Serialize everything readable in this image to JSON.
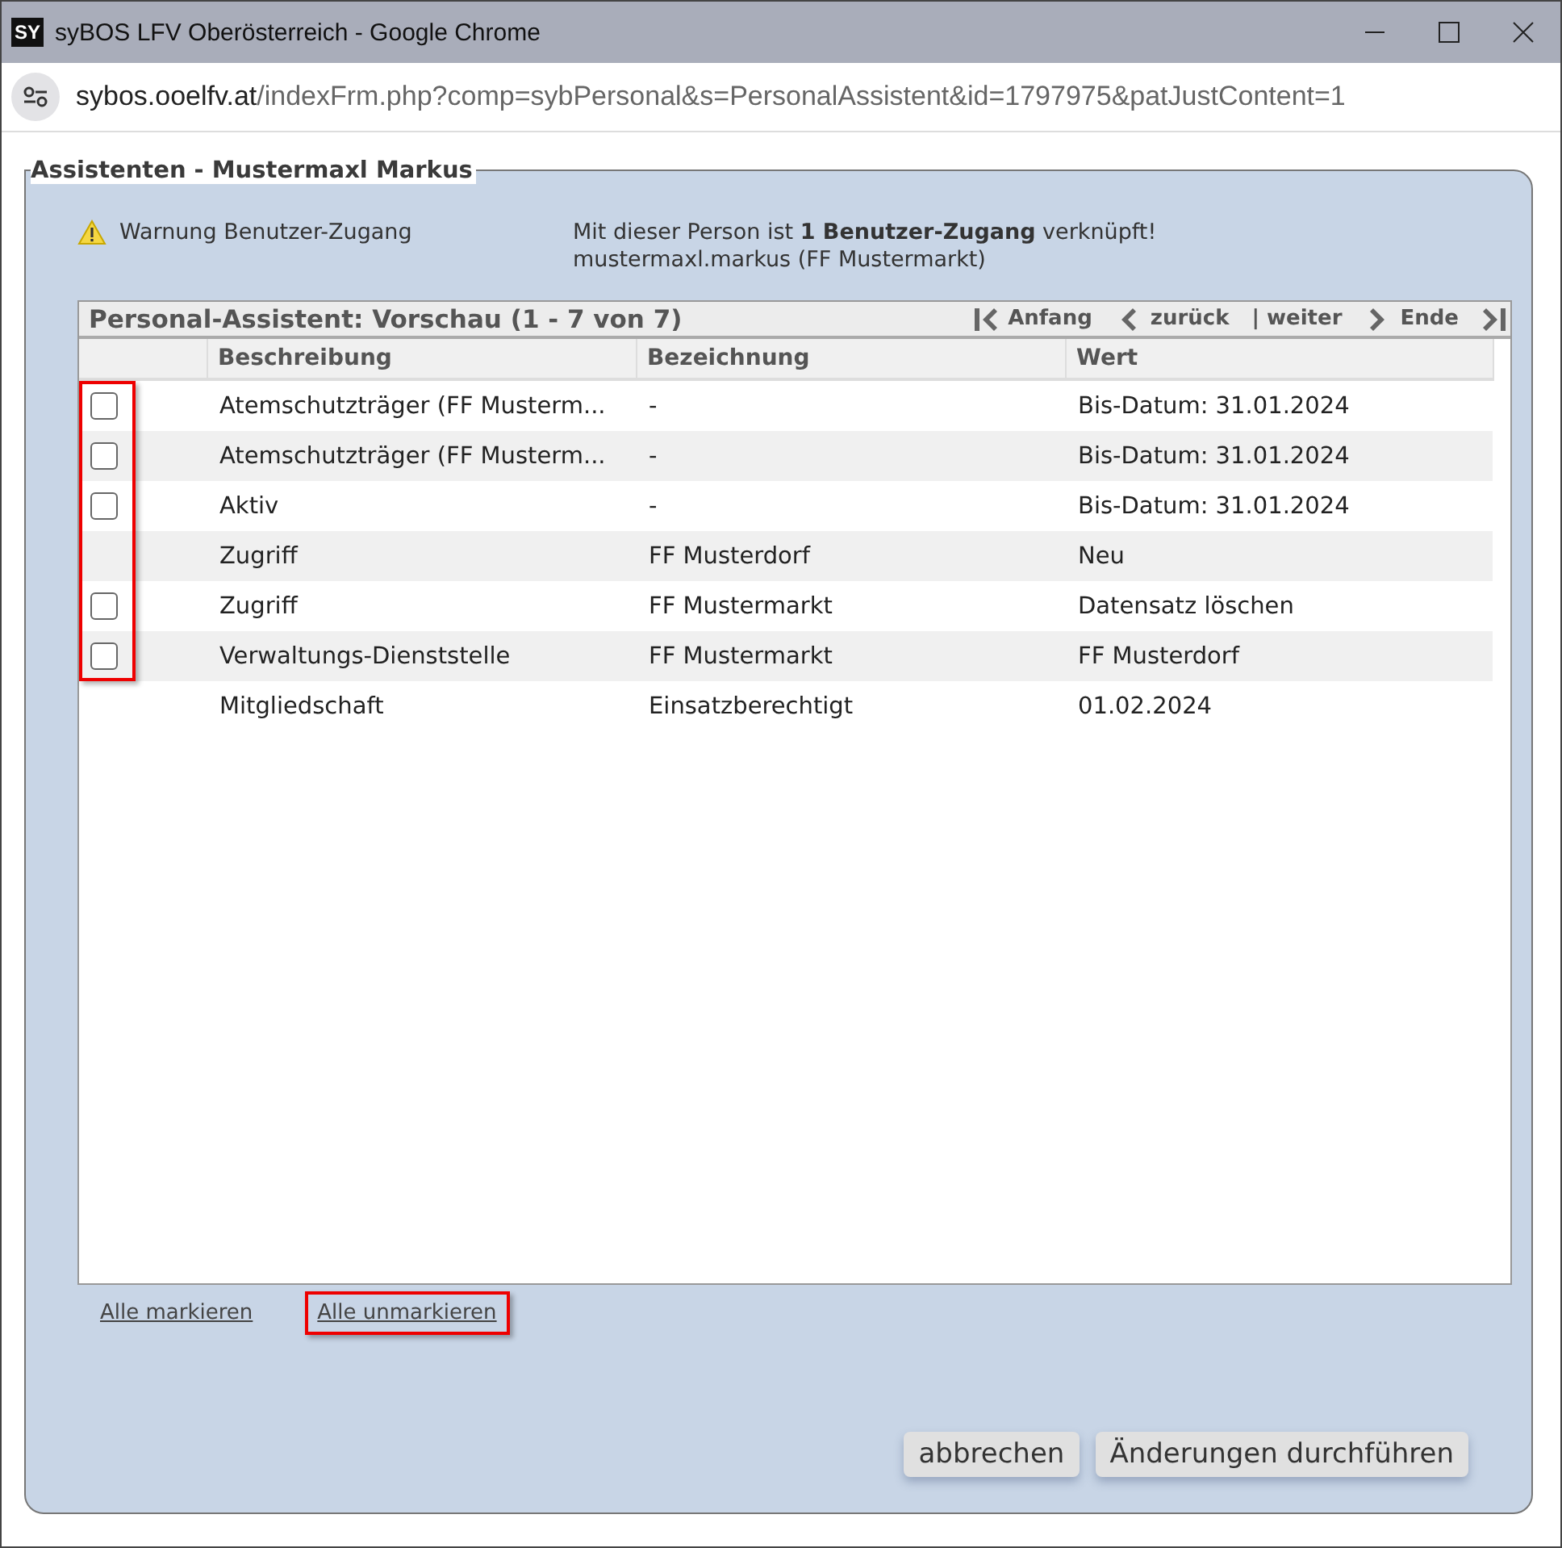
{
  "window": {
    "title": "syBOS LFV Oberösterreich - Google Chrome",
    "logo": "SY"
  },
  "address_bar": {
    "domain": "sybos.ooelfv.at",
    "path": "/indexFrm.php?comp=sybPersonal&s=PersonalAssistent&id=1797975&patJustContent=1"
  },
  "panel": {
    "title": "Assistenten - Mustermaxl Markus"
  },
  "warning": {
    "label": "Warnung Benutzer-Zugang",
    "message": "Mit dieser Person ist **1 Benutzer-Zugang** verknüpft!",
    "account": "mustermaxl.markus (FF Mustermarkt)"
  },
  "table": {
    "title": "Personal-Assistent: Vorschau (1 - 7 von 7)",
    "pager": [
      "Anfang",
      "zurück",
      "| weiter",
      "Ende"
    ],
    "columns": [
      "Beschreibung",
      "Bezeichnung",
      "Wert"
    ],
    "checkbox_column_highlighted": true,
    "rows": [
      {
        "kind": "checkbox",
        "checked": false,
        "cells": [
          "Atemschutzträger (FF Musterm...",
          "-",
          "Bis-Datum: 31.01.2024"
        ]
      },
      {
        "kind": "checkbox",
        "checked": false,
        "cells": [
          "Atemschutzträger (FF Musterm...",
          "-",
          "Bis-Datum: 31.01.2024"
        ]
      },
      {
        "kind": "checkbox",
        "checked": false,
        "cells": [
          "Aktiv",
          "-",
          "Bis-Datum: 31.01.2024"
        ]
      },
      {
        "kind": "plain",
        "cells": [
          "Zugriff",
          "FF Musterdorf",
          "Neu"
        ]
      },
      {
        "kind": "checkbox",
        "checked": false,
        "cells": [
          "Zugriff",
          "FF Mustermarkt",
          "Datensatz löschen"
        ]
      },
      {
        "kind": "checkbox",
        "checked": false,
        "cells": [
          "Verwaltungs-Dienststelle",
          "FF Mustermarkt",
          "FF Musterdorf"
        ]
      },
      {
        "kind": "plain",
        "cells": [
          "Mitgliedschaft",
          "Einsatzberechtigt",
          "01.02.2024"
        ]
      }
    ]
  },
  "links": [
    {
      "label": "Alle markieren",
      "highlighted": false
    },
    {
      "label": "Alle unmarkieren",
      "highlighted": true
    }
  ],
  "buttons": [
    "abbrechen",
    "Änderungen durchführen"
  ]
}
